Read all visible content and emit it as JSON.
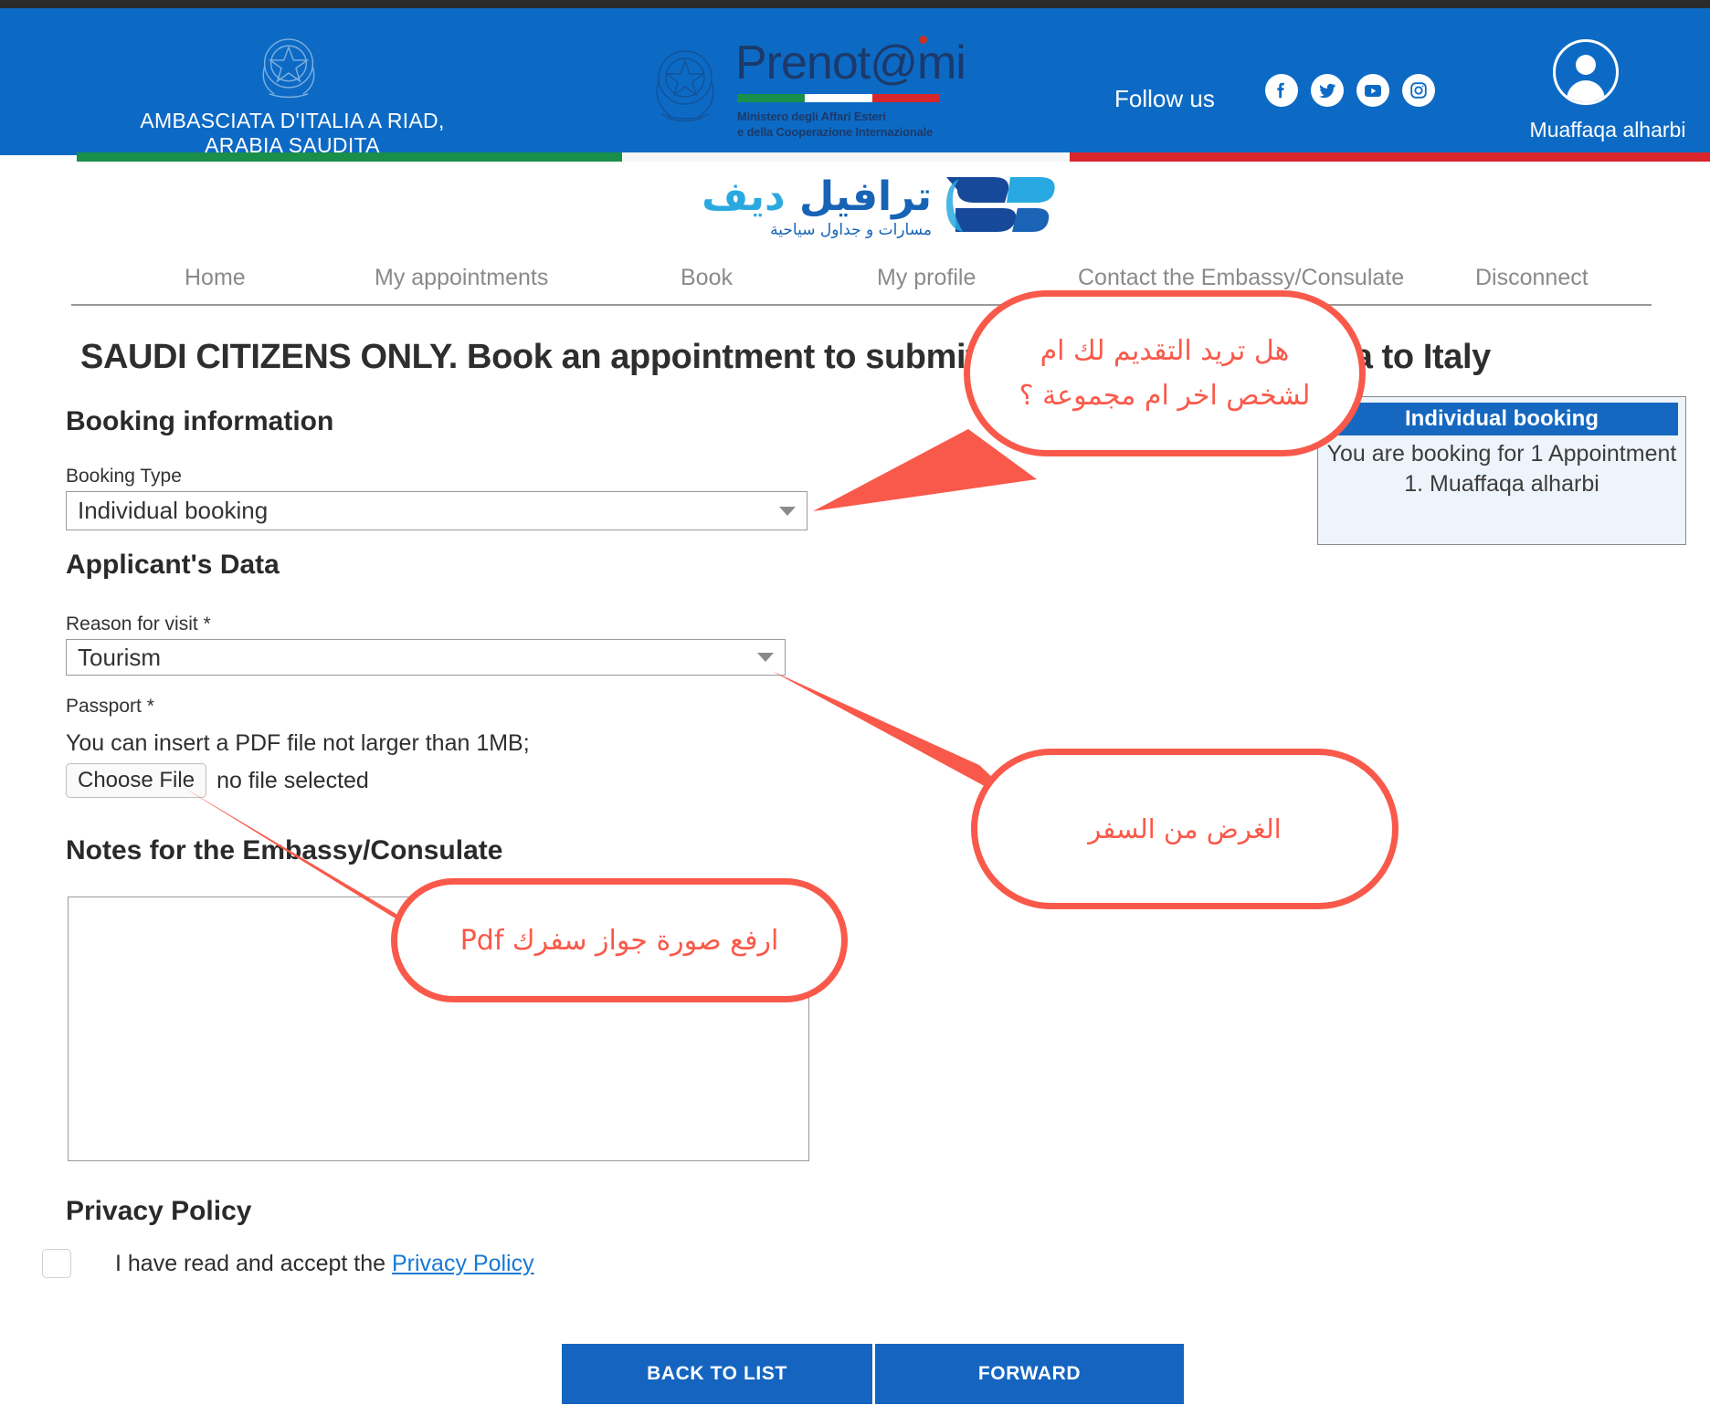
{
  "header": {
    "embassy_name": "AMBASCIATA D'ITALIA A RIAD,\nARABIA SAUDITA",
    "embassy_name_line1": "AMBASCIATA D'ITALIA A RIAD,",
    "embassy_name_line2": "ARABIA SAUDITA",
    "brand_word": "Prenot@mi",
    "ministero_line1": "Ministero degli Affari Esteri",
    "ministero_line2": "e della Cooperazione Internazionale",
    "follow_us": "Follow us",
    "socials": [
      "facebook-icon",
      "twitter-icon",
      "youtube-icon",
      "instagram-icon"
    ],
    "user_name": "Muaffaqa alharbi",
    "colors": {
      "header_blue": "#0d6ac4",
      "green": "#1a8f4a",
      "white": "#ffffff",
      "red": "#d7262c"
    }
  },
  "brand": {
    "arabic_title_strong": "ترافيل",
    "arabic_title_light": "ديف",
    "arabic_subtitle": "مسارات و جداول سياحية"
  },
  "nav": {
    "items": [
      {
        "label": "Home"
      },
      {
        "label": "My appointments"
      },
      {
        "label": "Book"
      },
      {
        "label": "My profile"
      },
      {
        "label": "Contact the Embassy/Consulate"
      },
      {
        "label": "Disconnect"
      }
    ]
  },
  "main": {
    "page_title": "SAUDI CITIZENS ONLY. Book an appointment to submit an application for a visa to Italy",
    "booking_information_heading": "Booking information",
    "booking_type_label": "Booking Type",
    "booking_type_value": "Individual booking",
    "applicants_data_heading": "Applicant's Data",
    "reason_label": "Reason for visit  *",
    "reason_value": "Tourism",
    "passport_label": "Passport  *",
    "passport_hint": "You can insert a PDF file not larger than 1MB;",
    "choose_file_button": "Choose File",
    "no_file_selected": "no file selected",
    "notes_heading": "Notes for the Embassy/Consulate",
    "notes_value": "",
    "privacy_heading": "Privacy Policy",
    "privacy_text": "I have read and accept the",
    "privacy_link": "Privacy Policy",
    "back_button": "BACK TO LIST",
    "forward_button": "FORWARD"
  },
  "info_panel": {
    "title": "Individual booking",
    "line1": "You are booking for 1 Appointment",
    "line2": "1. Muaffaqa alharbi"
  },
  "annotations": {
    "color": "#f9594a",
    "callout_1": "هل تريد التقديم لك ام لشخص اخر ام مجموعة ؟",
    "callout_2": "الغرض من السفر",
    "callout_3": "ارفع صورة جواز سفرك Pdf"
  }
}
